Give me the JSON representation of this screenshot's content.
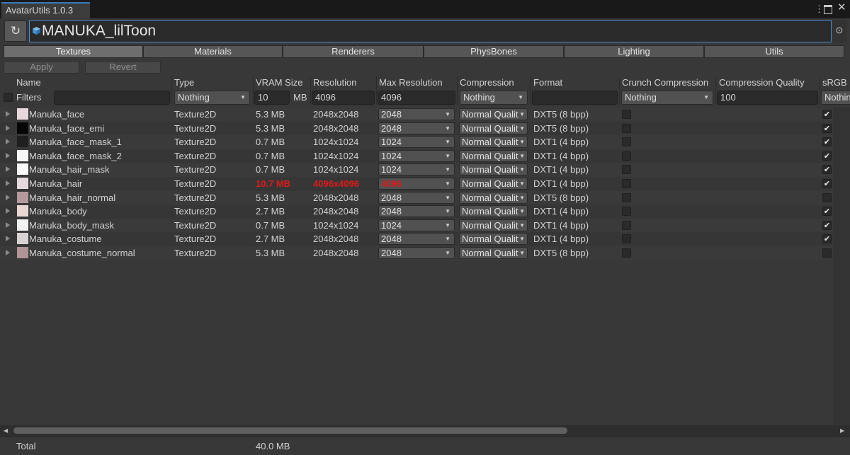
{
  "window": {
    "title": "AvatarUtils 1.0.3"
  },
  "toolbar": {
    "object_name": "MANUKA_lilToon"
  },
  "tabs": [
    "Textures",
    "Materials",
    "Renderers",
    "PhysBones",
    "Lighting",
    "Utils"
  ],
  "active_tab": "Textures",
  "actions": {
    "apply": "Apply",
    "revert": "Revert"
  },
  "columns": {
    "name": "Name",
    "type": "Type",
    "vram": "VRAM Size",
    "resolution": "Resolution",
    "max_resolution": "Max Resolution",
    "compression": "Compression",
    "format": "Format",
    "crunch": "Crunch Compression",
    "quality": "Compression Quality",
    "srgb": "sRGB"
  },
  "filters": {
    "label": "Filters",
    "name": "",
    "type": "Nothing",
    "vram": "10",
    "vram_unit": "MB",
    "resolution": "4096",
    "max_resolution": "4096",
    "compression": "Nothing",
    "format": "",
    "crunch": "Nothing",
    "quality": "100",
    "srgb": "Nothing"
  },
  "rows": [
    {
      "name": "Manuka_face",
      "type": "Texture2D",
      "vram": "5.3 MB",
      "resolution": "2048x2048",
      "max": "2048",
      "compression": "Normal Quality",
      "format": "DXT5 (8 bpp)",
      "crunch": false,
      "srgb": true,
      "warning": false,
      "thumb_icon": "face-thumbnail",
      "thumb_color": "#e8d8dc"
    },
    {
      "name": "Manuka_face_emi",
      "type": "Texture2D",
      "vram": "5.3 MB",
      "resolution": "2048x2048",
      "max": "2048",
      "compression": "Normal Quality",
      "format": "DXT5 (8 bpp)",
      "crunch": false,
      "srgb": true,
      "warning": false,
      "thumb_icon": "emission-thumbnail",
      "thumb_color": "#050505"
    },
    {
      "name": "Manuka_face_mask_1",
      "type": "Texture2D",
      "vram": "0.7 MB",
      "resolution": "1024x1024",
      "max": "1024",
      "compression": "Normal Quality",
      "format": "DXT1 (4 bpp)",
      "crunch": false,
      "srgb": true,
      "warning": false,
      "thumb_icon": "mask-thumbnail",
      "thumb_color": "#202020"
    },
    {
      "name": "Manuka_face_mask_2",
      "type": "Texture2D",
      "vram": "0.7 MB",
      "resolution": "1024x1024",
      "max": "1024",
      "compression": "Normal Quality",
      "format": "DXT1 (4 bpp)",
      "crunch": false,
      "srgb": true,
      "warning": false,
      "thumb_icon": "mask-thumbnail",
      "thumb_color": "#f6f6f6"
    },
    {
      "name": "Manuka_hair_mask",
      "type": "Texture2D",
      "vram": "0.7 MB",
      "resolution": "1024x1024",
      "max": "1024",
      "compression": "Normal Quality",
      "format": "DXT1 (4 bpp)",
      "crunch": false,
      "srgb": true,
      "warning": false,
      "thumb_icon": "mask-thumbnail",
      "thumb_color": "#fafafa"
    },
    {
      "name": "Manuka_hair",
      "type": "Texture2D",
      "vram": "10.7 MB",
      "resolution": "4096x4096",
      "max": "4096",
      "compression": "Normal Quality",
      "format": "DXT1 (4 bpp)",
      "crunch": false,
      "srgb": true,
      "warning": true,
      "thumb_icon": "hair-thumbnail",
      "thumb_color": "#e6d9dd"
    },
    {
      "name": "Manuka_hair_normal",
      "type": "Texture2D",
      "vram": "5.3 MB",
      "resolution": "2048x2048",
      "max": "2048",
      "compression": "Normal Quality",
      "format": "DXT5 (8 bpp)",
      "crunch": false,
      "srgb": false,
      "warning": false,
      "thumb_icon": "normal-map-thumbnail",
      "thumb_color": "#b49a9c"
    },
    {
      "name": "Manuka_body",
      "type": "Texture2D",
      "vram": "2.7 MB",
      "resolution": "2048x2048",
      "max": "2048",
      "compression": "Normal Quality",
      "format": "DXT1 (4 bpp)",
      "crunch": false,
      "srgb": true,
      "warning": false,
      "thumb_icon": "body-thumbnail",
      "thumb_color": "#ead7d3"
    },
    {
      "name": "Manuka_body_mask",
      "type": "Texture2D",
      "vram": "0.7 MB",
      "resolution": "1024x1024",
      "max": "1024",
      "compression": "Normal Quality",
      "format": "DXT1 (4 bpp)",
      "crunch": false,
      "srgb": true,
      "warning": false,
      "thumb_icon": "mask-thumbnail",
      "thumb_color": "#f2f2f2"
    },
    {
      "name": "Manuka_costume",
      "type": "Texture2D",
      "vram": "2.7 MB",
      "resolution": "2048x2048",
      "max": "2048",
      "compression": "Normal Quality",
      "format": "DXT1 (4 bpp)",
      "crunch": false,
      "srgb": true,
      "warning": false,
      "thumb_icon": "costume-thumbnail",
      "thumb_color": "#d9d2d2"
    },
    {
      "name": "Manuka_costume_normal",
      "type": "Texture2D",
      "vram": "5.3 MB",
      "resolution": "2048x2048",
      "max": "2048",
      "compression": "Normal Quality",
      "format": "DXT5 (8 bpp)",
      "crunch": false,
      "srgb": false,
      "warning": false,
      "thumb_icon": "normal-map-thumbnail",
      "thumb_color": "#b09496"
    }
  ],
  "footer": {
    "label": "Total",
    "total": "40.0 MB"
  },
  "colors": {
    "accent": "#3a79bb",
    "warning": "#e01a1a",
    "background": "#383838"
  }
}
